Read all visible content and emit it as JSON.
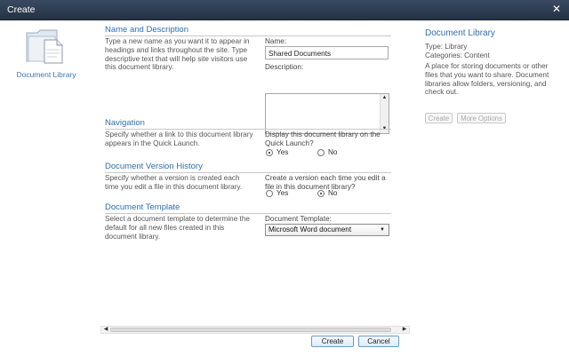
{
  "window": {
    "title": "Create"
  },
  "left": {
    "icon": "document-library-icon",
    "label": "Document Library"
  },
  "sections": {
    "name": {
      "title": "Name and Description",
      "description": "Type a new name as you want it to appear in headings and links throughout the site. Type descriptive text that will help site visitors use this document library.",
      "name_label": "Name:",
      "name_value": "Shared Documents",
      "description_label": "Description:",
      "description_value": ""
    },
    "navigation": {
      "title": "Navigation",
      "description": "Specify whether a link to this document library appears in the Quick Launch.",
      "question": "Display this document library on the Quick Launch?",
      "yes": "Yes",
      "no": "No",
      "selected": "Yes"
    },
    "versioning": {
      "title": "Document Version History",
      "description": "Specify whether a version is created each time you edit a file in this document library.",
      "question": "Create a version each time you edit a file in this document library?",
      "yes": "Yes",
      "no": "No",
      "selected": "No"
    },
    "template": {
      "title": "Document Template",
      "description": "Select a document template to determine the default for all new files created in this document library.",
      "label": "Document Template:",
      "selected": "Microsoft Word document"
    }
  },
  "rightpane": {
    "title": "Document Library",
    "type_line": "Type: Library",
    "categories_line": "Categories: Content",
    "description": "A place for storing documents or other files that you want to share. Document libraries allow folders, versioning, and check out.",
    "create_label": "Create",
    "more_label": "More Options"
  },
  "footer": {
    "create_label": "Create",
    "cancel_label": "Cancel"
  },
  "colors": {
    "accent": "#2f6fb0",
    "titlebar": "#2c3a4f"
  }
}
